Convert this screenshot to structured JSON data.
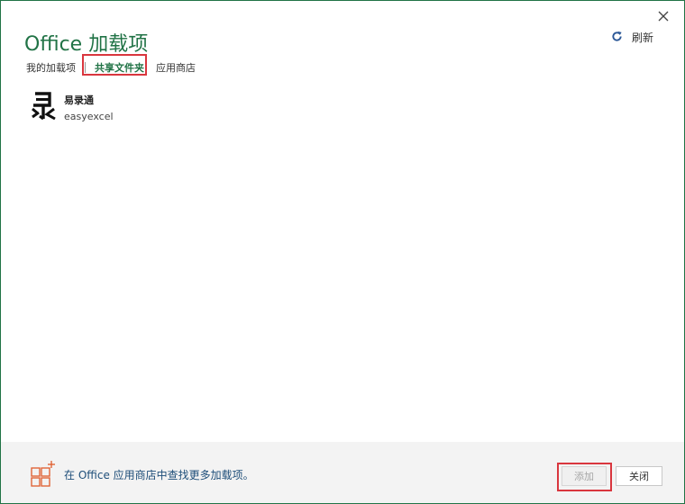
{
  "dialog": {
    "title": "Office 加载项",
    "refresh_label": "刷新",
    "tabs": [
      {
        "label": "我的加载项",
        "active": false
      },
      {
        "label": "共享文件夹",
        "active": true
      },
      {
        "label": "应用商店",
        "active": false
      }
    ]
  },
  "addins": [
    {
      "name": "易录通",
      "description": "easyexcel",
      "icon": "lu-character-logo-icon"
    }
  ],
  "footer": {
    "store_link": "在 Office 应用商店中查找更多加载项。",
    "add_button": "添加",
    "close_button": "关闭"
  },
  "colors": {
    "accent": "#217346",
    "highlight": "#d9363e",
    "footer_bg": "#f3f3f3",
    "link": "#1e4e79",
    "store_icon": "#e05a2b"
  }
}
